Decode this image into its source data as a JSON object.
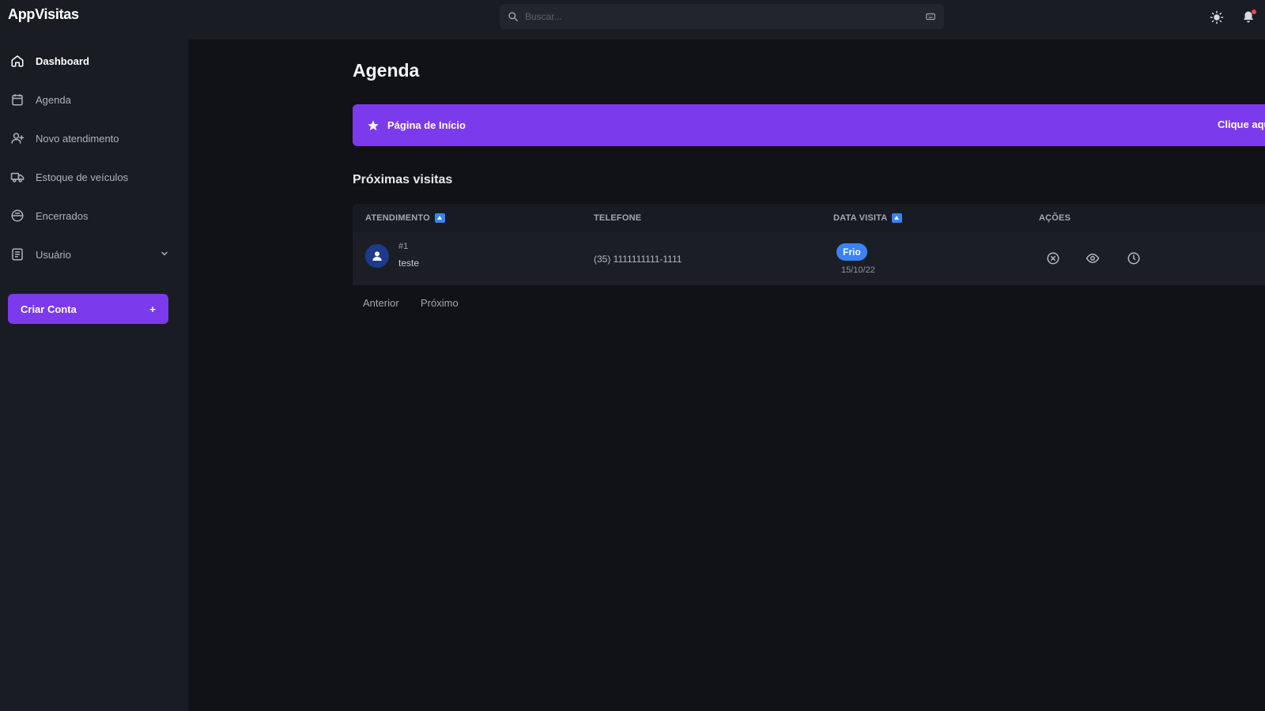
{
  "app": {
    "brand": "AppVisitas"
  },
  "header": {
    "search_placeholder": "Buscar...",
    "icons": [
      "search-icon",
      "keyboard-icon",
      "sun-icon",
      "bell-icon"
    ]
  },
  "sidebar": {
    "items": [
      {
        "label": "Dashboard",
        "icon": "home-icon",
        "active": true
      },
      {
        "label": "Agenda",
        "icon": "calendar-icon",
        "active": false
      },
      {
        "label": "Novo atendimento",
        "icon": "user-plus-icon",
        "active": false
      },
      {
        "label": "Estoque de veículos",
        "icon": "car-icon",
        "active": false
      },
      {
        "label": "Encerrados",
        "icon": "archive-icon",
        "active": false
      },
      {
        "label": "Usuário",
        "icon": "users-icon",
        "active": false,
        "expandable": true
      }
    ],
    "create_button": {
      "label": "Criar Conta",
      "icon": "+"
    }
  },
  "main": {
    "title": "Agenda",
    "banner": {
      "label": "Página de Início",
      "link": "Clique aqui"
    },
    "section_title": "Próximas visitas",
    "table": {
      "columns": [
        "ATENDIMENTO",
        "TELEFONE",
        "DATA VISITA",
        "AÇÕES"
      ],
      "rows": [
        {
          "id": "#1",
          "name": "teste",
          "phone": "(35) 1111111111-1111",
          "status": "Frio",
          "date": "15/10/22"
        }
      ]
    },
    "pagination": {
      "prev": "Anterior",
      "next": "Próximo"
    }
  },
  "colors": {
    "accent": "#7c3aed",
    "info": "#3b82f6",
    "background": "#111217",
    "panel": "#1a1c24"
  }
}
